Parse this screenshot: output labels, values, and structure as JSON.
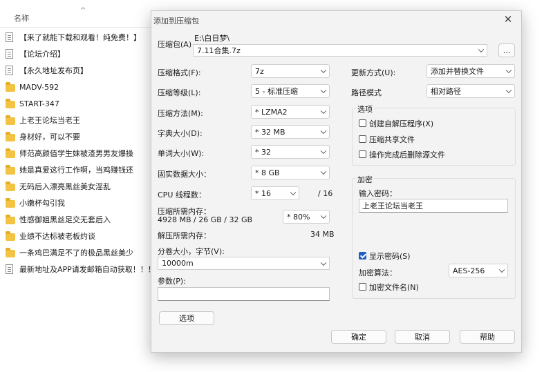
{
  "explorer": {
    "column_name": "名称",
    "sort_indicator": "^",
    "items": [
      {
        "icon": "doc-icon",
        "label": "【来了就能下载和观看！纯免费！】"
      },
      {
        "icon": "doc-icon",
        "label": "【论坛介绍】"
      },
      {
        "icon": "doc-icon",
        "label": "【永久地址发布页】"
      },
      {
        "icon": "folder-icon",
        "label": "MADV-592"
      },
      {
        "icon": "folder-icon",
        "label": "START-347"
      },
      {
        "icon": "folder-icon",
        "label": "上老王论坛当老王"
      },
      {
        "icon": "folder-icon",
        "label": "身材好，可以不要"
      },
      {
        "icon": "folder-icon",
        "label": "师范高颜值学生妹被渣男男友爆操"
      },
      {
        "icon": "folder-icon",
        "label": "她是真爱这行工作啊，当鸡赚钱还"
      },
      {
        "icon": "folder-icon",
        "label": "无码后入漂亮黑丝美女淫乱"
      },
      {
        "icon": "folder-icon",
        "label": "小嫩杯勾引我"
      },
      {
        "icon": "folder-icon",
        "label": "性感御姐黑丝足交无套后入"
      },
      {
        "icon": "folder-icon",
        "label": "业绩不达标被老板约谈"
      },
      {
        "icon": "folder-icon",
        "label": "一条鸡巴满足不了的极品黑丝美少"
      },
      {
        "icon": "doc-icon",
        "label": "最新地址及APP请发邮箱自动获取！！！"
      }
    ]
  },
  "dialog": {
    "title": "添加到压缩包",
    "close_symbol": "✕",
    "archive_label": "压缩包(A)",
    "archive_path": "E:\\白日梦\\",
    "archive_name": "7.11合集.7z",
    "browse_label": "...",
    "format_label": "压缩格式(F):",
    "format_value": "7z",
    "level_label": "压缩等级(L):",
    "level_value": "5 - 标准压缩",
    "method_label": "压缩方法(M):",
    "method_value": "* LZMA2",
    "dict_label": "字典大小(D):",
    "dict_value": "* 32 MB",
    "word_label": "单词大小(W):",
    "word_value": "* 32",
    "solid_label": "固实数据大小：",
    "solid_value": "* 8 GB",
    "cpu_label": "CPU 线程数：",
    "cpu_value": "* 16",
    "cpu_max": "/ 16",
    "mem_compress_label": "压缩所需内存：",
    "mem_compress_value": "4928 MB / 26 GB / 32 GB",
    "mem_percent_value": "* 80%",
    "mem_decompress_label": "解压所需内存：",
    "mem_decompress_value": "34 MB",
    "split_label": "分卷大小，字节(V):",
    "split_value": "10000m",
    "params_label": "参数(P):",
    "params_value": "",
    "options_button": "选项",
    "update_label": "更新方式(U):",
    "update_value": "添加并替换文件",
    "path_label": "路径模式",
    "path_value": "相对路径",
    "options_group_title": "选项",
    "opt_sfx": "创建自解压程序(X)",
    "opt_shared": "压缩共享文件",
    "opt_delete": "操作完成后删除源文件",
    "encrypt_group_title": "加密",
    "password_label": "输入密码：",
    "password_value": "上老王论坛当老王",
    "show_password_label": "显示密码(S)",
    "show_password_checked": true,
    "enc_method_label": "加密算法：",
    "enc_method_value": "AES-256",
    "encrypt_names_label": "加密文件名(N)",
    "ok_button": "确定",
    "cancel_button": "取消",
    "help_button": "帮助"
  },
  "colors": {
    "dialog_bg": "#f3f3f3",
    "checkbox_accent": "#1f5fbf",
    "folder": "#f3c443"
  }
}
